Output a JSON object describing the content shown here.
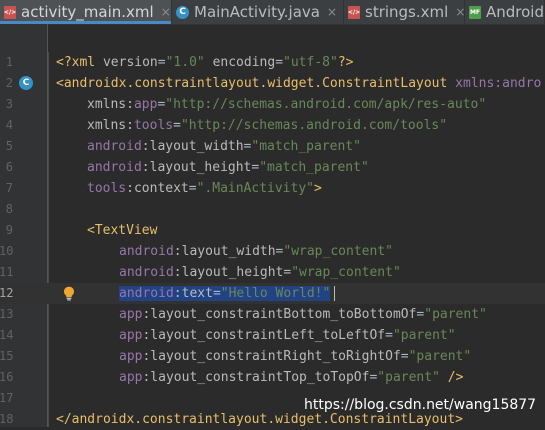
{
  "tabs": [
    {
      "label": "activity_main.xml",
      "icon": "xml-file-icon",
      "active": true
    },
    {
      "label": "MainActivity.java",
      "icon": "java-class-icon",
      "active": false
    },
    {
      "label": "strings.xml",
      "icon": "xml-file-icon",
      "active": false
    },
    {
      "label": "Android",
      "icon": "manifest-file-icon",
      "active": false
    }
  ],
  "icon_glyphs": {
    "xml": "</>",
    "java": "C",
    "manifest": "MF",
    "close": "×"
  },
  "line_numbers": [
    "1",
    "2",
    "3",
    "4",
    "5",
    "6",
    "7",
    "8",
    "9",
    "10",
    "11",
    "12",
    "13",
    "14",
    "15",
    "16",
    "17",
    "18"
  ],
  "code": {
    "l1": {
      "a": "<?xml ",
      "b": "version",
      "c": "=",
      "d": "\"1.0\"",
      "e": " ",
      "f": "encoding",
      "g": "=",
      "h": "\"utf-8\"",
      "i": "?>"
    },
    "l2": {
      "tag": "<androidx.constraintlayout.widget.ConstraintLayout ",
      "ns": "xmlns:andro"
    },
    "l3": {
      "ns": "xmlns:",
      "name": "app",
      "eq": "=",
      "val": "\"http://schemas.android.com/apk/res-auto\""
    },
    "l4": {
      "ns": "xmlns:",
      "name": "tools",
      "eq": "=",
      "val": "\"http://schemas.android.com/tools\""
    },
    "l5": {
      "ns": "android",
      "name": ":layout_width",
      "eq": "=",
      "val": "\"match_parent\""
    },
    "l6": {
      "ns": "android",
      "name": ":layout_height",
      "eq": "=",
      "val": "\"match_parent\""
    },
    "l7": {
      "ns": "tools",
      "name": ":context",
      "eq": "=",
      "val": "\".MainActivity\"",
      "end": ">"
    },
    "l9": {
      "tag": "<TextView"
    },
    "l10": {
      "ns": "android",
      "name": ":layout_width",
      "eq": "=",
      "val": "\"wrap_content\""
    },
    "l11": {
      "ns": "android",
      "name": ":layout_height",
      "eq": "=",
      "val": "\"wrap_content\""
    },
    "l12": {
      "ns": "android",
      "name": ":text",
      "eq": "=",
      "val": "\"Hello World!\""
    },
    "l13": {
      "ns": "app",
      "name": ":layout_constraintBottom_toBottomOf",
      "eq": "=",
      "val": "\"parent\""
    },
    "l14": {
      "ns": "app",
      "name": ":layout_constraintLeft_toLeftOf",
      "eq": "=",
      "val": "\"parent\""
    },
    "l15": {
      "ns": "app",
      "name": ":layout_constraintRight_toRightOf",
      "eq": "=",
      "val": "\"parent\""
    },
    "l16": {
      "ns": "app",
      "name": ":layout_constraintTop_toTopOf",
      "eq": "=",
      "val": "\"parent\"",
      "end": " />"
    },
    "l18": {
      "tag": "</androidx.constraintlayout.widget.ConstraintLayout>"
    }
  },
  "watermark": "https://blog.csdn.net/wang15877",
  "colors": {
    "background": "#2b2b2b",
    "gutter": "#313335",
    "tag": "#e8bf6a",
    "namespace": "#9876aa",
    "attribute": "#bababa",
    "string": "#6a8759",
    "selection": "#214283",
    "tab_underline": "#4a88c7"
  }
}
